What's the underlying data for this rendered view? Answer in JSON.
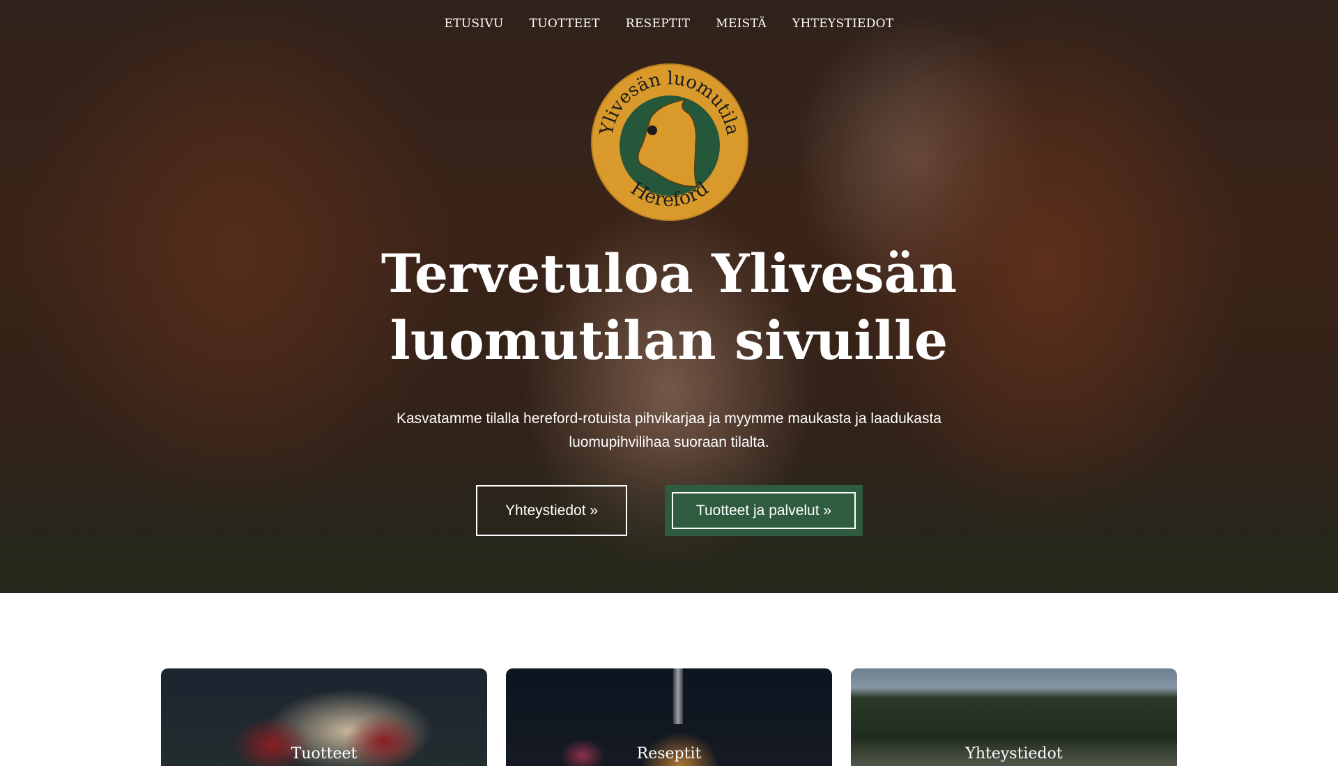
{
  "nav": {
    "items": [
      "ETUSIVU",
      "TUOTTEET",
      "RESEPTIT",
      "MEISTÄ",
      "YHTEYSTIEDOT"
    ]
  },
  "logo": {
    "top_text": "Ylivesän luomutila",
    "bottom_text": "Hereford"
  },
  "hero": {
    "title_line1": "Tervetuloa Ylivesän",
    "title_line2": "luomutilan sivuille",
    "lead_line1": "Kasvatamme tilalla hereford-rotuista pihvikarjaa ja myymme maukasta ja laadukasta",
    "lead_line2": "luomupihvilihaa suoraan tilalta.",
    "button_contact": "Yhteystiedot »",
    "button_products": "Tuotteet ja palvelut »"
  },
  "cards": [
    {
      "label": "Tuotteet"
    },
    {
      "label": "Reseptit"
    },
    {
      "label": "Yhteystiedot"
    }
  ],
  "colors": {
    "brand_green": "#2f5c3f",
    "logo_gold": "#d99a2b",
    "logo_green": "#25573a"
  }
}
